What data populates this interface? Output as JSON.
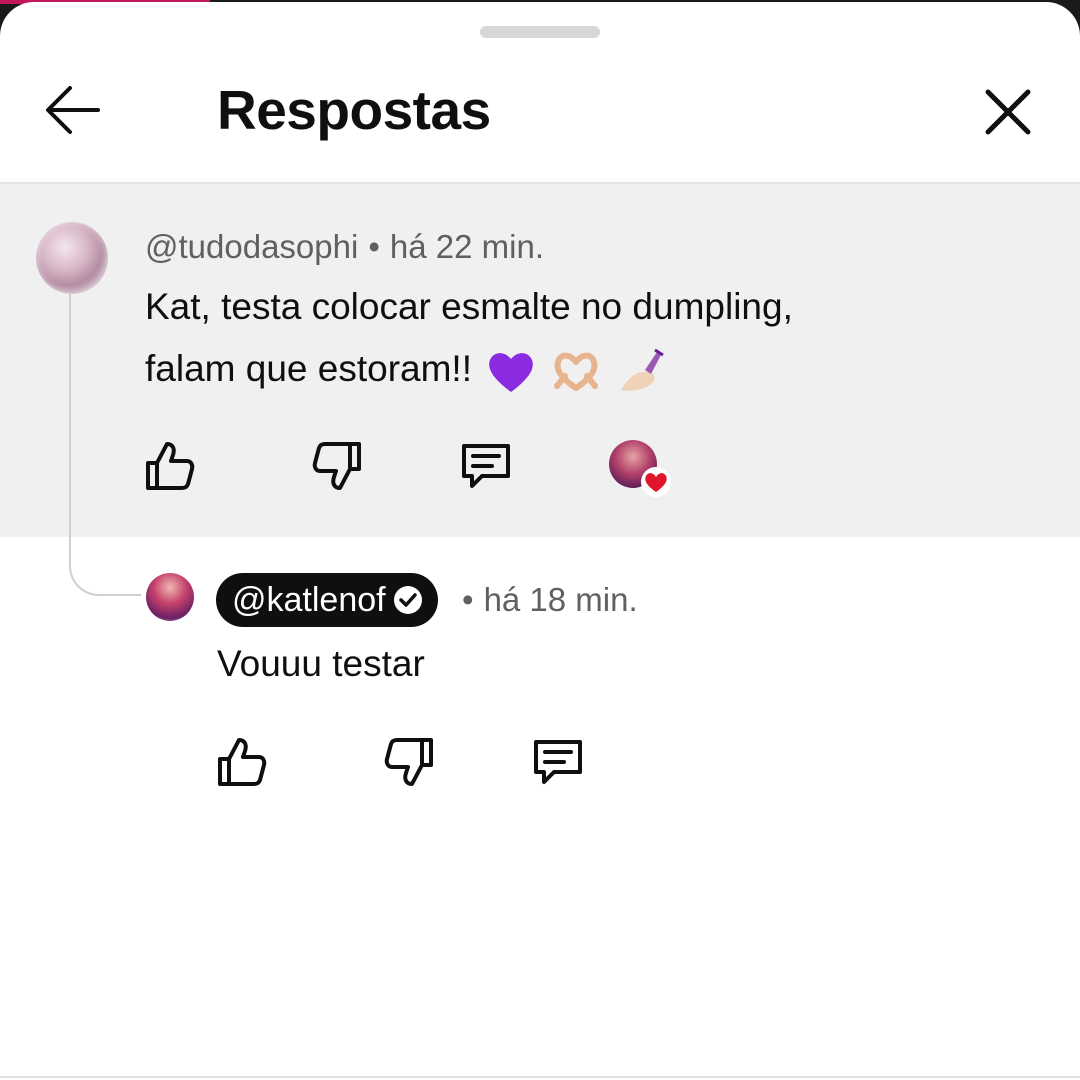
{
  "header": {
    "title": "Respostas",
    "back_icon": "arrow-left-icon",
    "close_icon": "close-icon"
  },
  "parent_comment": {
    "author": "@tudodasophi",
    "separator": "•",
    "time": "há 22 min.",
    "text_line1": "Kat, testa colocar esmalte no dumpling,",
    "text_line2": "falam que estoram!!",
    "emojis": [
      "purple-heart",
      "heart-hands",
      "nail-polish"
    ],
    "actions": [
      "like-icon",
      "dislike-icon",
      "reply-icon",
      "creator-heart-icon"
    ],
    "creator_heart_color": "#e0142a"
  },
  "reply": {
    "author": "@katlenof",
    "verified": true,
    "separator": "•",
    "time": "há 18 min.",
    "text": "Vouuu testar",
    "actions": [
      "like-icon",
      "dislike-icon",
      "reply-icon"
    ]
  },
  "colors": {
    "parent_background": "#f0f0f0",
    "chip_background": "#0f0f0f",
    "meta_text": "#606060"
  }
}
